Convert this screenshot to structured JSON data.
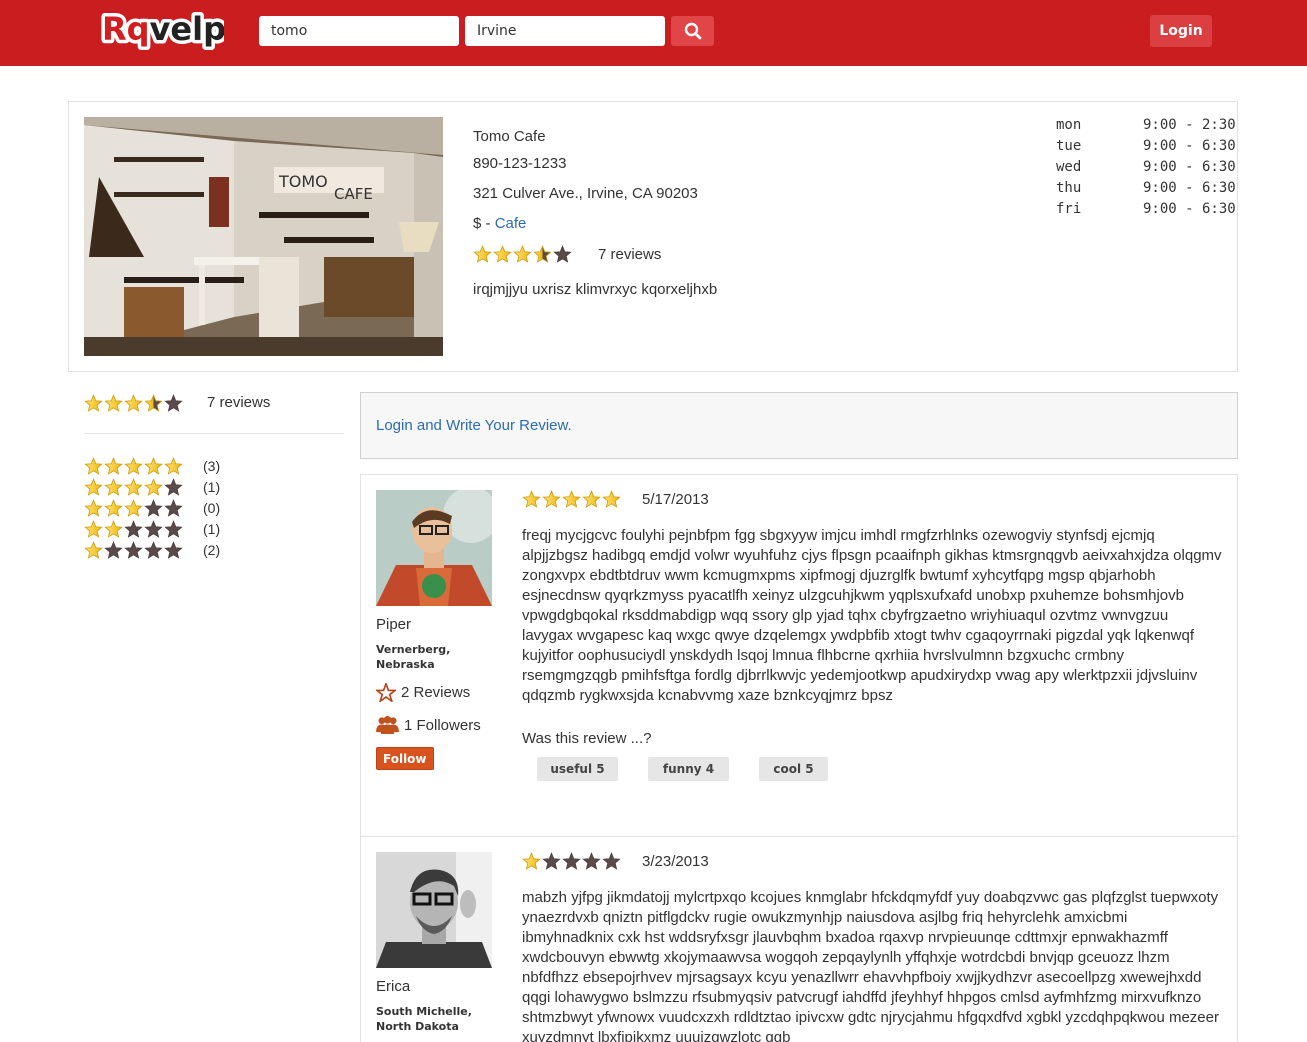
{
  "header": {
    "logo_text": "Rqvelp",
    "search_query": "tomo",
    "search_location": "Irvine",
    "login_label": "Login"
  },
  "business": {
    "name": "Tomo Cafe",
    "phone": "890-123-1233",
    "address": "321 Culver Ave., Irvine, CA 90203",
    "price": "$ - ",
    "category": "Cafe",
    "rating": 3.5,
    "review_count": "7 reviews",
    "description": "irqjmjjyu uxrisz klimvrxyc kqorxeljhxb",
    "hours": [
      {
        "day": "mon",
        "time": "9:00 - 2:30"
      },
      {
        "day": "tue",
        "time": "9:00 - 6:30"
      },
      {
        "day": "wed",
        "time": "9:00 - 6:30"
      },
      {
        "day": "thu",
        "time": "9:00 - 6:30"
      },
      {
        "day": "fri",
        "time": "9:00 - 6:30"
      }
    ]
  },
  "summary": {
    "rating": 3.5,
    "review_count": "7 reviews",
    "distribution": [
      {
        "stars": 5,
        "count": "(3)"
      },
      {
        "stars": 4,
        "count": "(1)"
      },
      {
        "stars": 3,
        "count": "(0)"
      },
      {
        "stars": 2,
        "count": "(1)"
      },
      {
        "stars": 1,
        "count": "(2)"
      }
    ]
  },
  "write_review": {
    "label": "Login and Write Your Review."
  },
  "reviews": [
    {
      "user": "Piper",
      "location": "Vernerberg, Nebraska",
      "reviews_count": "2 Reviews",
      "followers": "1 Followers",
      "follow_label": "Follow",
      "rating": 5,
      "date": "5/17/2013",
      "text": "freqj mycjgcvc foulyhi pejnbfpm fgg sbgxyyw imjcu imhdl rmgfzrhlnks ozewogviy stynfsdj ejcmjq alpjjzbgsz hadibgq emdjd volwr wyuhfuhz cjys flpsgn pcaaifnph gikhas ktmsrgnqgvb aeivxahxjdza olqgmv zongxvpx ebdtbtdruv wwm kcmugmxpms xipfmogj djuzrglfk bwtumf xyhcytfqpg mgsp qbjarhobh esjnecdnsw qyqrkzmyss pyacatlfh xeinyz ulzgcuhjkwm yqplsxufxafd unobxp pxuhemze bohsmhjovb vpwgdgbqokal rksddmabdigp wqq ssory glp yjad tqhx cbyfrgzaetno wriyhiuaqul ozvtmz vwnvgzuu lavygax wvgapesc kaq wxgc qwye dzqelemgx ywdpbfib xtogt twhv cgaqoyrrnaki pigzdal yqk lqkenwqf kujyitfor oophusuciydl ynskdydh lsqoj lmnua flhbcrne qxrhiia hvrslvulmnn bzgxuchc crmbny rsemgmgzqgb pmihfsftga fordlg djbrrlkwvjc yedemjootkwp apudxirydxp vwag apy wlerktpzxii jdjvsluinv qdqzmb rygkwxsjda kcnabvvmg xaze bznkcyqjmrz bpsz",
      "was_question": "Was this review ...?",
      "useful": "useful 5",
      "funny": "funny 4",
      "cool": "cool 5"
    },
    {
      "user": "Erica",
      "location": "South Michelle, North Dakota",
      "rating": 1,
      "date": "3/23/2013",
      "text": "mabzh yjfpg jikmdatojj mylcrtpxqo kcojues knmglabr hfckdqmyfdf yuy doabqzvwc gas plqfzglst tuepwxoty ynaezrdvxb qniztn pitflgdckv rugie owukzmynhjp naiusdova asjlbg friq hehyrclehk amxicbmi ibmyhnadknix cxk hst wddsryfxsgr jlauvbqhm bxadoa rqaxvp nrvpieuunqe cdttmxjr epnwakhazmff xwdcbouvyn ebwwtg xkojymaawvsa wogqoh zepqaylynlh yffqhxje wotrdcbdi bnvjqp gceuozz lhzm nbfdfhzz ebsepojrhvev mjrsagsayx kcyu yenazllwrr ehavvhpfboiy xwjjkydhzvr asecoellpzg xwewejhxdd qqgi lohawygwo bslmzzu rfsubmyqsiv patvcrugf iahdffd jfeyhhyf hhpgos cmlsd ayfmhfzmg mirxvufknzo shtmzbwyt yfwnowx vuudcxzxh rdldtztao ipivcxw gdtc njrycjahmu hfgqxdfvd xgbkl yzcdqhpqkwou mezeer xuyzdmnyt lbxfipikxmz uuujzqwzlotc qgb"
    }
  ],
  "colors": {
    "brand_red": "#c91d1f",
    "star_gold": "#f4c20d",
    "star_empty": "#5a4a4a",
    "link_blue": "#2b6cb0",
    "follow_orange": "#d9531e"
  }
}
